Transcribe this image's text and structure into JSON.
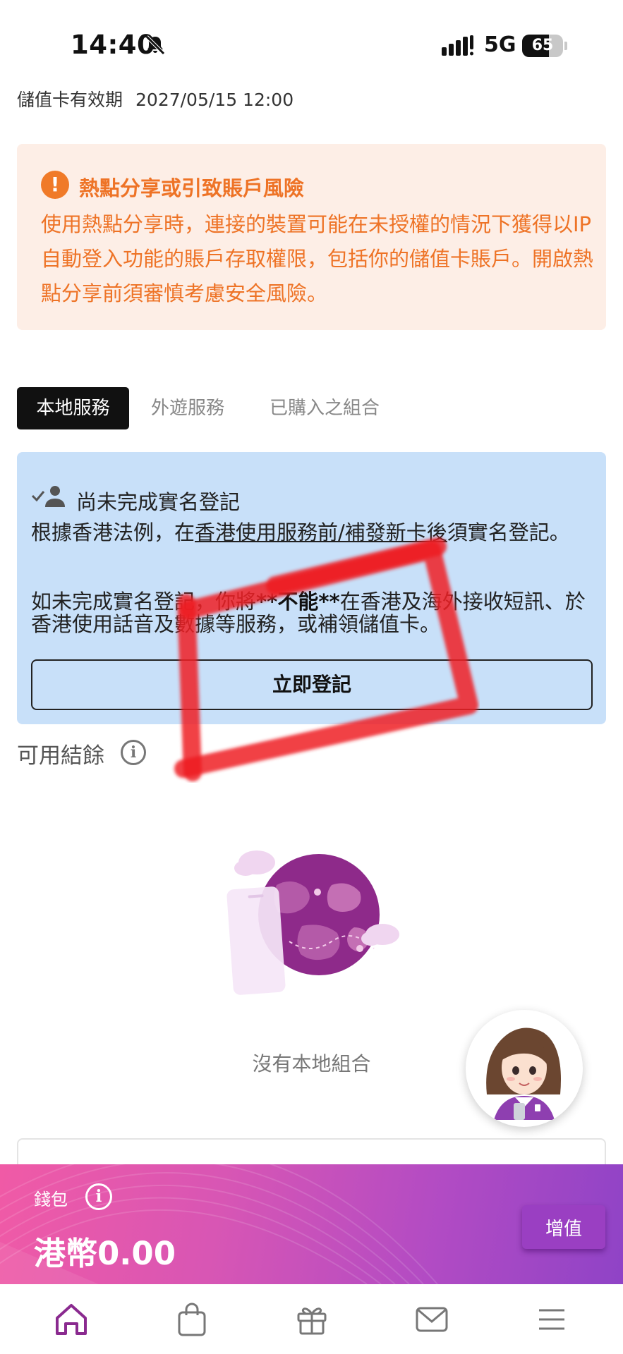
{
  "status_bar": {
    "time": "14:40",
    "network": "5G",
    "battery_level": "65"
  },
  "validity": {
    "label": "儲值卡有效期",
    "date": "2027/05/15 12:00"
  },
  "warning": {
    "icon": "exclamation-icon",
    "title": "熱點分享或引致賬戶風險",
    "body": "使用熱點分享時，連接的裝置可能在未授權的情況下獲得以IP自動登入功能的賬戶存取權限，包括你的儲值卡賬戶。開啟熱點分享前須審慎考慮安全風險。"
  },
  "tabs": [
    {
      "label": "本地服務",
      "active": true
    },
    {
      "label": "外遊服務",
      "active": false
    },
    {
      "label": "已購入之組合",
      "active": false
    }
  ],
  "registration": {
    "title": "尚未完成實名登記",
    "text1_prefix": "根據香港法例，在",
    "text1_link": "香港使用服務前/補發新卡後",
    "text1_suffix": "須實名登記。",
    "text2_prefix": "如未完成實名登記，你將",
    "text2_emphasis": "**不能**",
    "text2_suffix": "在香港及海外接收短訊、於香港使用話音及數據等服務，或補領儲值卡。",
    "button": "立即登記"
  },
  "balance": {
    "label": "可用結餘"
  },
  "empty_state": {
    "text": "沒有本地組合"
  },
  "wallet": {
    "label": "錢包",
    "amount": "港幣0.00",
    "topup_button": "增值"
  },
  "bottom_nav": [
    {
      "icon": "home-icon",
      "active": true
    },
    {
      "icon": "shopping-bag-icon",
      "active": false
    },
    {
      "icon": "gift-icon",
      "active": false
    },
    {
      "icon": "mail-icon",
      "active": false
    },
    {
      "icon": "menu-icon",
      "active": false
    }
  ],
  "colors": {
    "warning_accent": "#ee7326",
    "warning_bg": "#fdeee6",
    "registration_bg": "#c8e0f9",
    "brand_purple": "#8a2a8f",
    "wallet_gradient_start": "#f05aa6",
    "wallet_gradient_end": "#8f43c6"
  }
}
